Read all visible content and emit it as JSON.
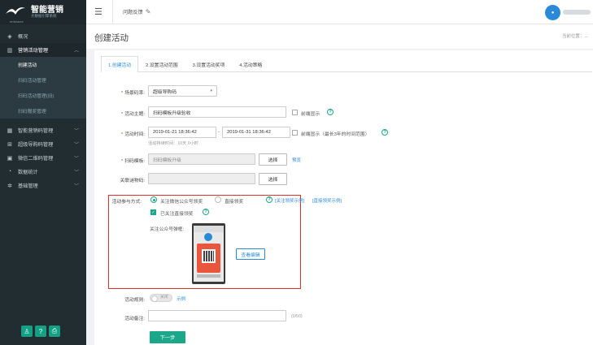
{
  "brand": {
    "title": "智能营销",
    "tagline": "大数据引擎系统",
    "sub": "midasxe"
  },
  "sidebar": {
    "items": [
      {
        "label": "概况",
        "icon": "layers-icon"
      },
      {
        "label": "营销活动管理",
        "icon": "bar-chart-icon",
        "open": true
      },
      {
        "label": "智能营销码管理",
        "icon": "qr-icon"
      },
      {
        "label": "超级导购码管理",
        "icon": "cart-icon"
      },
      {
        "label": "微信二维码管理",
        "icon": "wechat-icon"
      },
      {
        "label": "数据统计",
        "icon": "pie-icon"
      },
      {
        "label": "基础管理",
        "icon": "gear-icon"
      }
    ],
    "sub_items": [
      "创建活动",
      "扫码活动管理",
      "扫码活动管理(旧)",
      "扫码赠奖管理"
    ]
  },
  "topbar": {
    "feedback": "问题反馈"
  },
  "page": {
    "title": "创建活动",
    "breadcrumb_prefix": "当前位置：",
    "breadcrumb_link": "..."
  },
  "tabs": [
    "1.创建活动",
    "2.设置活动范围",
    "3.设置活动奖项",
    "4.活动策略"
  ],
  "form": {
    "scene_label": "场景码率:",
    "scene_value": "超级导购码",
    "theme_label": "活动主题:",
    "theme_value": "扫码模板升级验收",
    "front_display": "前端显示",
    "time_label": "活动时间:",
    "start_time": "2019-01-21 18:36:42",
    "time_dash": "-",
    "end_time": "2019-01-31 18:36:42",
    "time_front": "前端显示（最长3年的时间范围）",
    "duration_hint": "活动持续时间：10天 0小时",
    "template_label": "扫码模板:",
    "template_value": "扫码模板升级",
    "choose": "选择",
    "preview": "预览",
    "related_label": "关联谜物码:",
    "related_value": "",
    "participate_label": "活动参与方式:",
    "mode_wechat": "关注微信公众号领奖",
    "mode_direct": "直接领奖",
    "link_follow": "[关注领奖示例]",
    "link_direct": "[直接领奖示例]",
    "followed_direct": "已关注直接领奖",
    "popup_label": "关注公众号弹框:",
    "view_edit": "查看编辑",
    "rule_label": "活动规则:",
    "rule_toggle": "关闭",
    "rule_example": "示例",
    "remark_label": "活动备注:",
    "remark_count": "(0/50)",
    "next": "下一步"
  },
  "colors": {
    "sidebar": "#222d32",
    "accent": "#1aa78a",
    "link": "#2b8ad8",
    "highlight": "#e0302c"
  }
}
